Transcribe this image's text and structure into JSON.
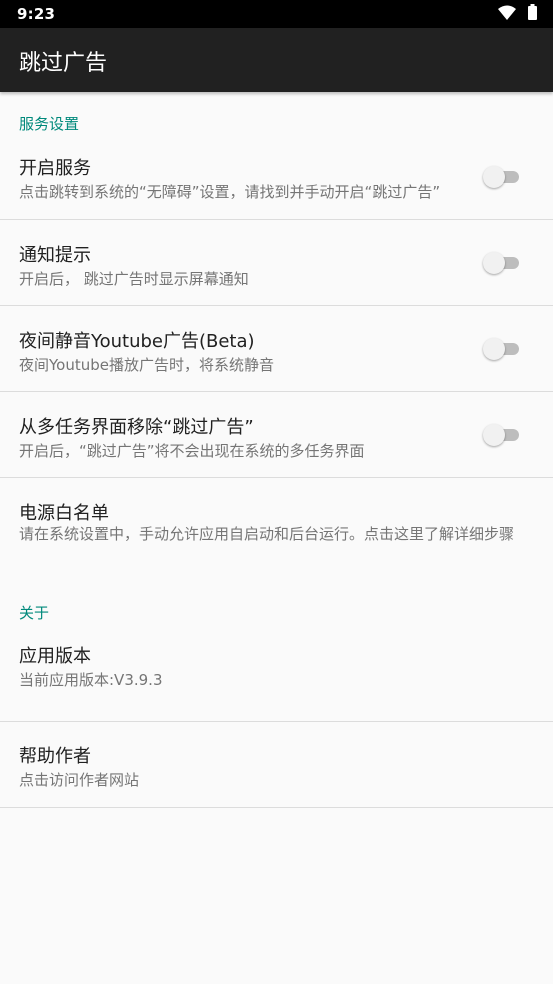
{
  "status_bar": {
    "time": "9:23",
    "icons": [
      "wifi-icon",
      "battery-icon"
    ]
  },
  "app_bar": {
    "title": "跳过广告"
  },
  "sections": {
    "service": {
      "header": "服务设置",
      "items": [
        {
          "title": "开启服务",
          "summary": "点击跳转到系统的“无障碍”设置，请找到并手动开启“跳过广告”",
          "switch_on": false
        },
        {
          "title": "通知提示",
          "summary": "开启后， 跳过广告时显示屏幕通知",
          "switch_on": false
        },
        {
          "title": "夜间静音Youtube广告(Beta)",
          "summary": "夜间Youtube播放广告时，将系统静音",
          "switch_on": false
        },
        {
          "title": "从多任务界面移除“跳过广告”",
          "summary": "开启后，“跳过广告”将不会出现在系统的多任务界面",
          "switch_on": false
        },
        {
          "title": "电源白名单",
          "summary": "请在系统设置中，手动允许应用自启动和后台运行。点击这里了解详细步骤"
        }
      ]
    },
    "about": {
      "header": "关于",
      "items": [
        {
          "title": "应用版本",
          "summary": "当前应用版本:V3.9.3"
        },
        {
          "title": "帮助作者",
          "summary": "点击访问作者网站"
        }
      ]
    }
  },
  "colors": {
    "accent": "#00897b",
    "app_bar": "#212121",
    "status_bar": "#000000",
    "background": "#fafafa"
  }
}
